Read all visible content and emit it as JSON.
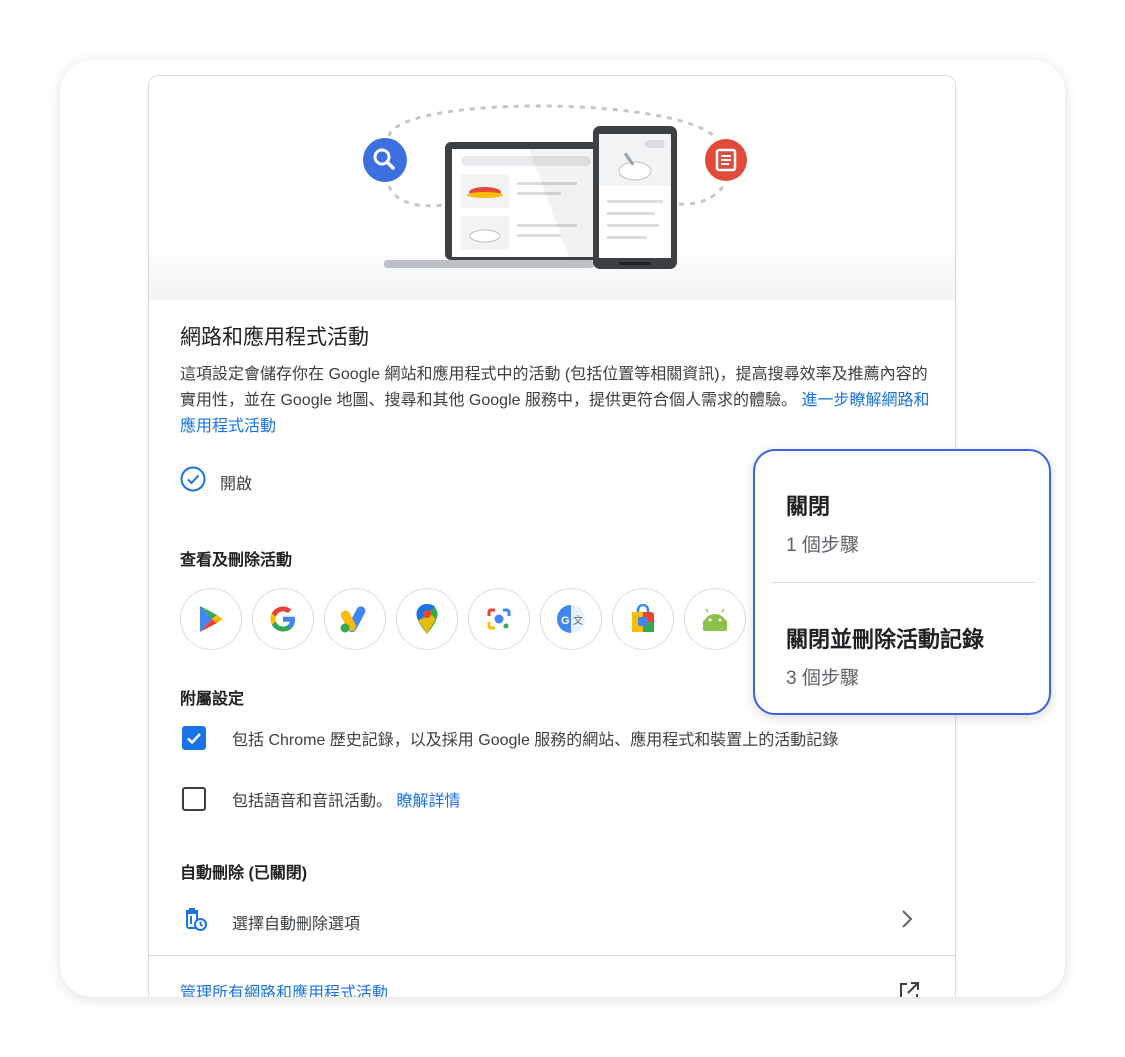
{
  "section": {
    "title": "網路和應用程式活動",
    "description": "這項設定會儲存你在 Google 網站和應用程式中的活動 (包括位置等相關資訊)，提高搜尋效率及推薦內容的實用性，並在 Google 地圖、搜尋和其他 Google 服務中，提供更符合個人需求的體驗。",
    "learn_more_link": "進一步瞭解網路和應用程式活動",
    "status": "開啟"
  },
  "view_delete": {
    "heading": "查看及刪除活動",
    "apps": [
      "google-play-icon",
      "google-g-icon",
      "google-ads-icon",
      "google-maps-icon",
      "google-lens-icon",
      "google-translate-icon",
      "google-shopping-icon",
      "android-icon"
    ]
  },
  "sub_settings": {
    "heading": "附屬設定",
    "chrome_history": {
      "label": "包括 Chrome 歷史記錄，以及採用 Google 服務的網站、應用程式和裝置上的活動記錄",
      "checked": true
    },
    "voice_audio": {
      "label": "包括語音和音訊活動。",
      "link": "瞭解詳情",
      "checked": false
    }
  },
  "auto_delete": {
    "heading": "自動刪除 (已關閉)",
    "option_label": "選擇自動刪除選項"
  },
  "footer": {
    "manage_link": "管理所有網路和應用程式活動"
  },
  "popup": {
    "option1": {
      "title": "關閉",
      "steps": "1 個步驟"
    },
    "option2": {
      "title": "關閉並刪除活動記錄",
      "steps": "3 個步驟"
    }
  },
  "colors": {
    "accent": "#1a73e8",
    "popup_border": "#3b63e8",
    "divider": "#dadce0"
  }
}
